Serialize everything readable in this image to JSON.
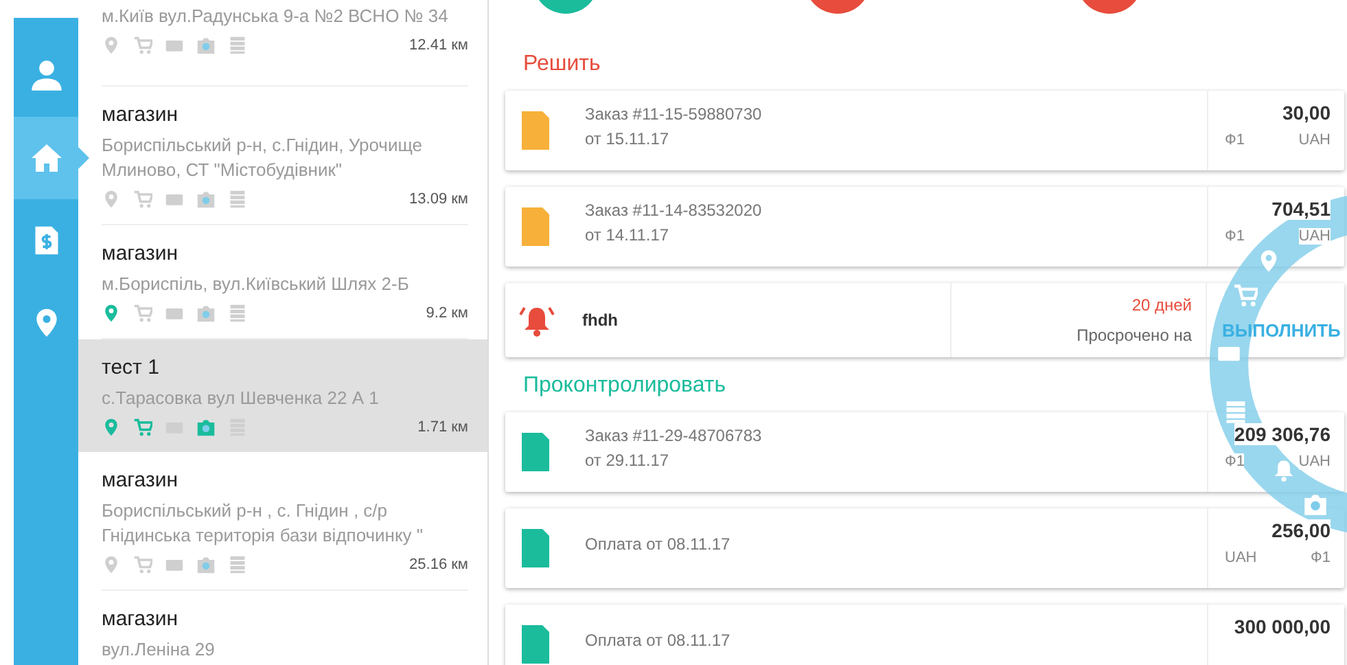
{
  "sidebar": {
    "items": [
      {
        "selected": false
      },
      {
        "selected": true
      },
      {
        "selected": false
      },
      {
        "selected": false
      }
    ]
  },
  "stores": [
    {
      "address": "м.Київ вул.Радунська 9-а №2 ВСНО № 34",
      "distance": "12.41 км",
      "selected": false,
      "flags": {
        "pin": false,
        "cart": false,
        "card": false,
        "camera": false,
        "list": false
      }
    },
    {
      "title": "магазин",
      "address": "Бориспільський р-н, с.Гнідин, Урочище Млиново, СТ \"Містобудівник\"",
      "distance": "13.09 км",
      "selected": false,
      "flags": {
        "pin": false,
        "cart": false,
        "card": false,
        "camera": false,
        "list": false
      }
    },
    {
      "title": "магазин",
      "address": "м.Бориспіль, вул.Київський Шлях 2-Б",
      "distance": "9.2 км",
      "selected": false,
      "flags": {
        "pin": true,
        "cart": false,
        "card": false,
        "camera": false,
        "list": false
      }
    },
    {
      "title": "тест 1",
      "address": "с.Тарасовка вул Шевченка 22 А 1",
      "distance": "1.71 км",
      "selected": true,
      "flags": {
        "pin": true,
        "cart": true,
        "card": false,
        "camera": true,
        "list": false
      }
    },
    {
      "title": "магазин",
      "address": "Бориспільський р-н , с. Гнідин , с/р Гнідинська територія бази відпочинку \"",
      "distance": "25.16 км",
      "selected": false,
      "flags": {
        "pin": false,
        "cart": false,
        "card": false,
        "camera": false,
        "list": false
      }
    },
    {
      "title": "магазин",
      "address": "вул.Леніна 29"
    }
  ],
  "top_indicators": [
    {
      "color": "#1abc9c"
    },
    {
      "color": "#e74c3c"
    },
    {
      "color": "#e74c3c"
    }
  ],
  "sections": [
    {
      "title": "Решить",
      "kind": "solve",
      "cards": [
        {
          "kind": "document",
          "color": "#f7b03a",
          "line1": "Заказ #11-15-59880730",
          "line2": "от 15.11.17",
          "amount": "30,00",
          "sub_left": "Ф1",
          "sub_right": "UAH"
        },
        {
          "kind": "document",
          "color": "#f7b03a",
          "line1": "Заказ #11-14-83532020",
          "line2": "от 14.11.17",
          "amount": "704,51",
          "sub_left": "Ф1",
          "sub_right": "UAH"
        },
        {
          "kind": "alert",
          "title": "fhdh",
          "days": "20 дней",
          "overdue": "Просрочено на"
        }
      ]
    },
    {
      "title": "Проконтролировать",
      "kind": "control",
      "cards": [
        {
          "kind": "document",
          "color": "#1abc9c",
          "line1": "Заказ #11-29-48706783",
          "line2": "от 29.11.17",
          "amount": "209 306,76",
          "sub_left": "Ф1",
          "sub_right": "UAH"
        },
        {
          "kind": "document",
          "color": "#1abc9c",
          "line1": "Оплата от 08.11.17",
          "amount": "256,00",
          "sub_left": "UAH",
          "sub_right": "Ф1"
        },
        {
          "kind": "document",
          "color": "#1abc9c",
          "line1": "Оплата от 08.11.17",
          "amount": "300 000,00"
        }
      ]
    }
  ],
  "action_ring": {
    "label": "ВЫПОЛНИТЬ"
  }
}
